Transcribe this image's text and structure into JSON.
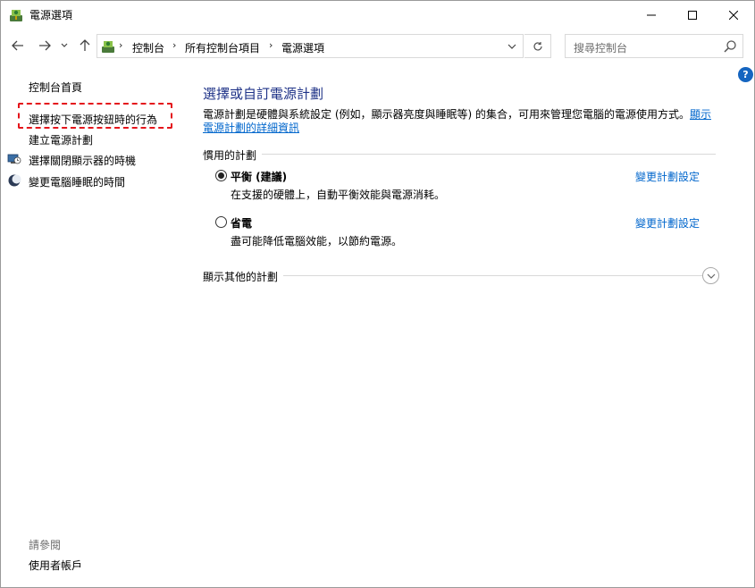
{
  "window": {
    "title": "電源選項",
    "buttons": {
      "minimize": "minimize",
      "maximize": "maximize",
      "close": "close"
    }
  },
  "address": {
    "crumbs": [
      "控制台",
      "所有控制台項目",
      "電源選項"
    ]
  },
  "search": {
    "placeholder": "搜尋控制台"
  },
  "sidebar": {
    "home": "控制台首頁",
    "items": [
      {
        "label": "選擇按下電源按鈕時的行為",
        "icon": "none"
      },
      {
        "label": "建立電源計劃",
        "icon": "none"
      },
      {
        "label": "選擇關閉顯示器的時機",
        "icon": "monitor-clock-icon"
      },
      {
        "label": "變更電腦睡眠的時間",
        "icon": "moon-icon"
      }
    ],
    "see_also": "請參閱",
    "user_accounts": "使用者帳戶"
  },
  "main": {
    "title": "選擇或自訂電源計劃",
    "description": "電源計劃是硬體與系統設定 (例如，顯示器亮度與睡眠等) 的集合，可用來管理您電腦的電源使用方式。",
    "description_link": "顯示電源計劃的詳細資訊",
    "section_label": "慣用的計劃",
    "plans": [
      {
        "name": "平衡 (建議)",
        "desc": "在支援的硬體上，自動平衡效能與電源消耗。",
        "change": "變更計劃設定",
        "selected": true
      },
      {
        "name": "省電",
        "desc": "盡可能降低電腦效能，以節約電源。",
        "change": "變更計劃設定",
        "selected": false
      }
    ],
    "more_plans": "顯示其他的計劃"
  },
  "colors": {
    "title_blue": "#1e3287",
    "link_blue": "#0066cc",
    "highlight_red": "#e4141b",
    "help_blue": "#1565c0"
  }
}
